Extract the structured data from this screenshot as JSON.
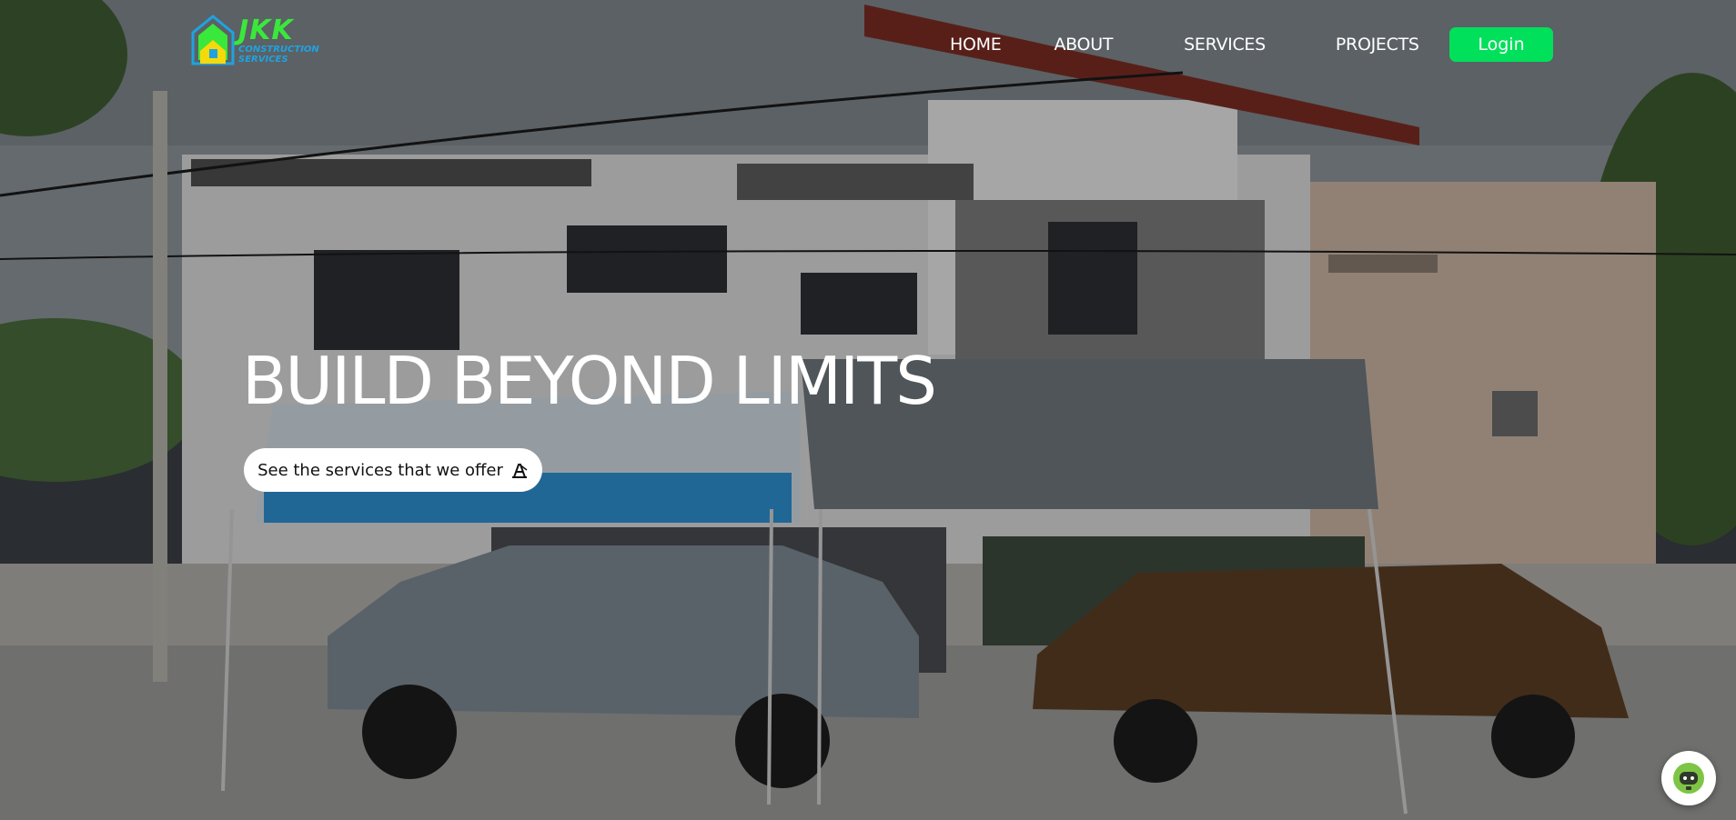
{
  "brand": {
    "name": "JKK",
    "subtitle": "Construction Services"
  },
  "nav": {
    "links": [
      {
        "label": "HOME"
      },
      {
        "label": "ABOUT"
      },
      {
        "label": "SERVICES"
      },
      {
        "label": "PROJECTS"
      }
    ],
    "login_label": "Login"
  },
  "hero": {
    "title": "BUILD BEYOND LIMITS",
    "cta_label": "See the services that we offer"
  },
  "icons": {
    "logo": "house-logo-icon",
    "cta": "crane-icon",
    "chat": "chatbot-icon"
  },
  "colors": {
    "accent": "#00e05a",
    "logo_green": "#39e83a",
    "logo_blue": "#1fa3e0"
  }
}
